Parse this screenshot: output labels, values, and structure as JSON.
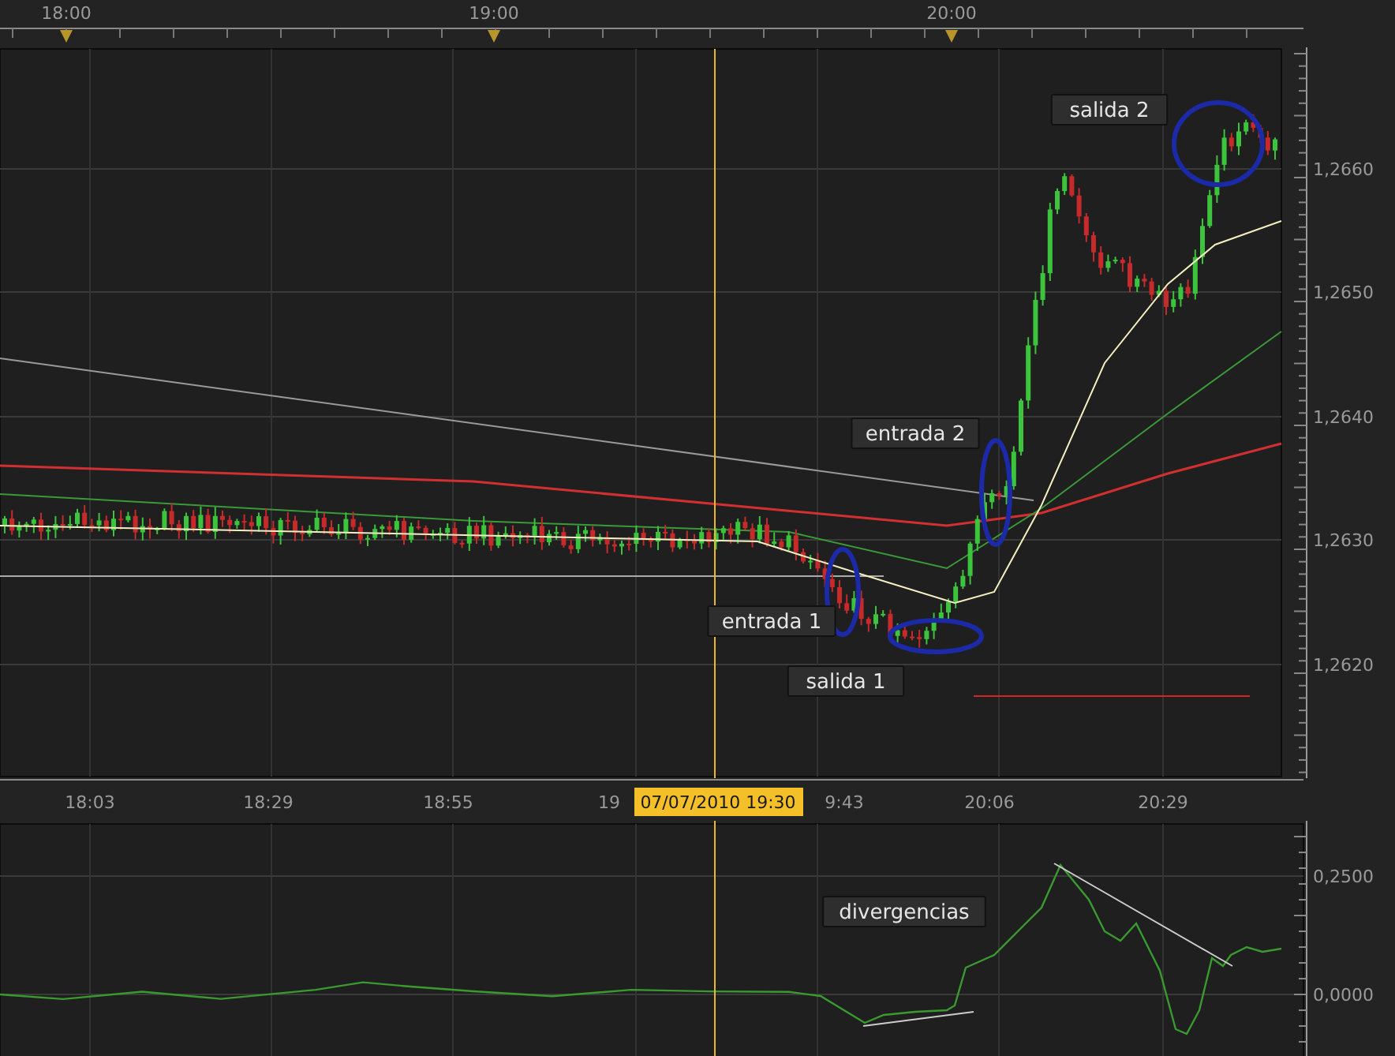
{
  "top_axis": {
    "labels": [
      "18:00",
      "19:00",
      "20:00"
    ]
  },
  "price_axis": {
    "labels": [
      "1,2660",
      "1,2650",
      "1,2640",
      "1,2630",
      "1,2620"
    ]
  },
  "annotations": [
    {
      "text": "salida 2"
    },
    {
      "text": "entrada 2"
    },
    {
      "text": "entrada 1"
    },
    {
      "text": "salida 1"
    }
  ],
  "time_axis": {
    "labels": [
      "18:03",
      "18:29",
      "18:55",
      "19",
      "9:43",
      "20:06",
      "20:29"
    ]
  },
  "crosshair_tooltip": "07/07/2010 19:30",
  "oscillator": {
    "annotation": "divergencias",
    "axis_labels": [
      "0,2500",
      "0,0000"
    ]
  }
}
